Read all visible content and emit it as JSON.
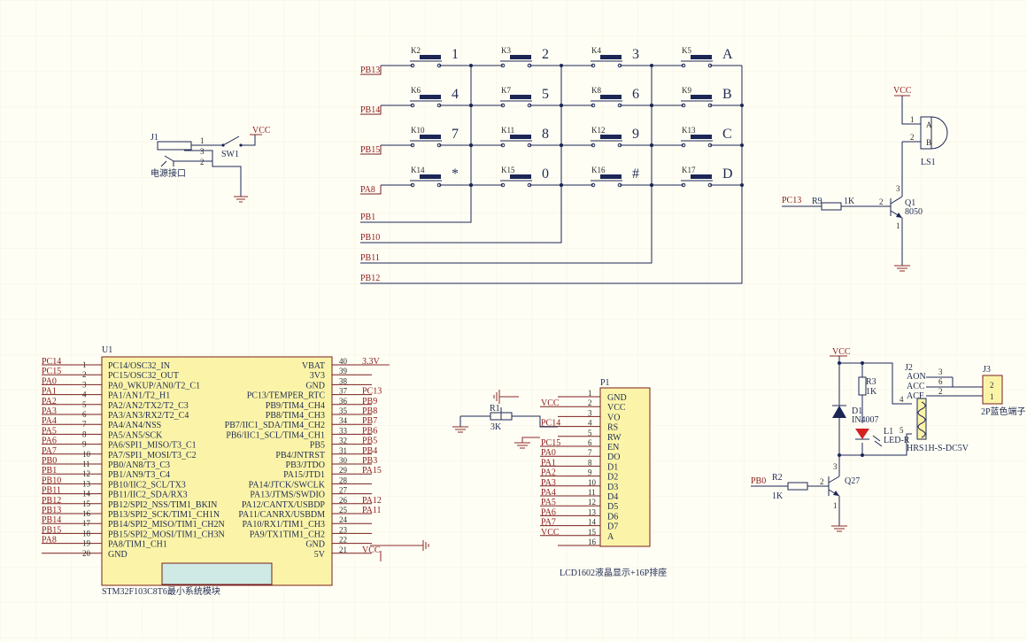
{
  "keypad": {
    "rows": [
      "PB13",
      "PB14",
      "PB15",
      "PA8"
    ],
    "cols": [
      "PB1",
      "PB10",
      "PB11",
      "PB12"
    ],
    "keys": [
      [
        {
          "ref": "K2",
          "label": "1"
        },
        {
          "ref": "K3",
          "label": "2"
        },
        {
          "ref": "K4",
          "label": "3"
        },
        {
          "ref": "K5",
          "label": "A"
        }
      ],
      [
        {
          "ref": "K6",
          "label": "4"
        },
        {
          "ref": "K7",
          "label": "5"
        },
        {
          "ref": "K8",
          "label": "6"
        },
        {
          "ref": "K9",
          "label": "B"
        }
      ],
      [
        {
          "ref": "K10",
          "label": "7"
        },
        {
          "ref": "K11",
          "label": "8"
        },
        {
          "ref": "K12",
          "label": "9"
        },
        {
          "ref": "K13",
          "label": "C"
        }
      ],
      [
        {
          "ref": "K14",
          "label": "*"
        },
        {
          "ref": "K15",
          "label": "0"
        },
        {
          "ref": "K16",
          "label": "#"
        },
        {
          "ref": "K17",
          "label": "D"
        }
      ]
    ]
  },
  "power": {
    "jack": "J1",
    "switch": "SW1",
    "vcc": "VCC",
    "label": "电源接口",
    "pins": [
      "1",
      "3",
      "2"
    ]
  },
  "buzzer": {
    "vcc": "VCC",
    "ref": "LS1",
    "pins": [
      "1",
      "2"
    ],
    "pin_names": [
      "A",
      "B"
    ],
    "net": "PC13",
    "res_ref": "R9",
    "res_val": "1K",
    "q_ref": "Q1",
    "q_type": "8050",
    "q_pins": [
      "2",
      "3",
      "1"
    ]
  },
  "mcu": {
    "ref": "U1",
    "title": "STM32F103C8T6最小系统模块",
    "left": [
      {
        "net": "PC14",
        "num": "1",
        "name": "PC14/OSC32_IN"
      },
      {
        "net": "PC15",
        "num": "2",
        "name": "PC15/OSC32_OUT"
      },
      {
        "net": "PA0",
        "num": "3",
        "name": "PA0_WKUP/AN0/T2_C1"
      },
      {
        "net": "PA1",
        "num": "4",
        "name": "PA1/AN1/T2_H1"
      },
      {
        "net": "PA2",
        "num": "5",
        "name": "PA2/AN2/TX2/T2_C3"
      },
      {
        "net": "PA3",
        "num": "6",
        "name": "PA3/AN3/RX2/T2_C4"
      },
      {
        "net": "PA4",
        "num": "7",
        "name": "PA4/AN4/NSS"
      },
      {
        "net": "PA5",
        "num": "8",
        "name": "PA5/AN5/SCK"
      },
      {
        "net": "PA6",
        "num": "9",
        "name": "PA6/SPI1_MISO/T3_C1"
      },
      {
        "net": "PA7",
        "num": "10",
        "name": "PA7/SPI1_MOSI/T3_C2"
      },
      {
        "net": "PB0",
        "num": "11",
        "name": "PB0/AN8/T3_C3"
      },
      {
        "net": "PB1",
        "num": "12",
        "name": "PB1/AN9/T3_C4"
      },
      {
        "net": "PB10",
        "num": "13",
        "name": "PB10/IIC2_SCL/TX3"
      },
      {
        "net": "PB11",
        "num": "14",
        "name": "PB11/IIC2_SDA/RX3"
      },
      {
        "net": "PB12",
        "num": "15",
        "name": "PB12/SPI2_NSS/TIM1_BKIN"
      },
      {
        "net": "PB13",
        "num": "16",
        "name": "PB13/SPI2_SCK/TIM1_CH1N"
      },
      {
        "net": "PB14",
        "num": "17",
        "name": "PB14/SPI2_MISO/TIM1_CH2N"
      },
      {
        "net": "PB15",
        "num": "18",
        "name": "PB15/SPI2_MOSI/TIM1_CH3N"
      },
      {
        "net": "PA8",
        "num": "19",
        "name": "PA8/TIM1_CH1"
      },
      {
        "net": "",
        "num": "20",
        "name": "GND"
      }
    ],
    "right": [
      {
        "name": "VBAT",
        "num": "40",
        "net": "3.3V"
      },
      {
        "name": "3V3",
        "num": "39",
        "net": ""
      },
      {
        "name": "GND",
        "num": "38",
        "net": ""
      },
      {
        "name": "PC13/TEMPER_RTC",
        "num": "37",
        "net": "PC13"
      },
      {
        "name": "PB9/TIM4_CH4",
        "num": "36",
        "net": "PB9"
      },
      {
        "name": "PB8/TIM4_CH3",
        "num": "35",
        "net": "PB8"
      },
      {
        "name": "PB7/IIC1_SDA/TIM4_CH2",
        "num": "34",
        "net": "PB7"
      },
      {
        "name": "PB6/IIC1_SCL/TIM4_CH1",
        "num": "33",
        "net": "PB6"
      },
      {
        "name": "PB5",
        "num": "32",
        "net": "PB5"
      },
      {
        "name": "PB4/JNTRST",
        "num": "31",
        "net": "PB4"
      },
      {
        "name": "PB3/JTDO",
        "num": "30",
        "net": "PB3"
      },
      {
        "name": "PA15/JTD1",
        "num": "29",
        "net": "PA15"
      },
      {
        "name": "PA14/JTCK/SWCLK",
        "num": "28",
        "net": ""
      },
      {
        "name": "PA13/JTMS/SWDIO",
        "num": "27",
        "net": ""
      },
      {
        "name": "PA12/CANTX/USBDP",
        "num": "26",
        "net": "PA12"
      },
      {
        "name": "PA11/CANRX/USBDM",
        "num": "25",
        "net": "PA11"
      },
      {
        "name": "PA10/RX1/TIM1_CH3",
        "num": "24",
        "net": ""
      },
      {
        "name": "PA9/TX1TIM1_CH2",
        "num": "23",
        "net": ""
      },
      {
        "name": "GND",
        "num": "22",
        "net": ""
      },
      {
        "name": "5V",
        "num": "21",
        "net": "VCC"
      }
    ]
  },
  "lcd": {
    "ref": "P1",
    "title": "LCD1602液晶显示+16P排座",
    "pins": [
      {
        "num": "1",
        "name": "GND",
        "net": ""
      },
      {
        "num": "2",
        "name": "VCC",
        "net": "VCC"
      },
      {
        "num": "3",
        "name": "VO",
        "net": ""
      },
      {
        "num": "4",
        "name": "RS",
        "net": "PC14"
      },
      {
        "num": "5",
        "name": "RW",
        "net": ""
      },
      {
        "num": "6",
        "name": "EN",
        "net": "PC15"
      },
      {
        "num": "7",
        "name": "DO",
        "net": "PA0"
      },
      {
        "num": "8",
        "name": "D1",
        "net": "PA1"
      },
      {
        "num": "9",
        "name": "D2",
        "net": "PA2"
      },
      {
        "num": "10",
        "name": "D3",
        "net": "PA3"
      },
      {
        "num": "11",
        "name": "D4",
        "net": "PA4"
      },
      {
        "num": "12",
        "name": "D5",
        "net": "PA5"
      },
      {
        "num": "13",
        "name": "D6",
        "net": "PA6"
      },
      {
        "num": "14",
        "name": "D7",
        "net": "PA7"
      },
      {
        "num": "15",
        "name": "A",
        "net": "VCC"
      },
      {
        "num": "16",
        "name": "",
        "net": ""
      }
    ],
    "res_ref": "R1",
    "res_val": "3K"
  },
  "relay": {
    "vcc": "VCC",
    "r3_ref": "R3",
    "r3_val": "1K",
    "d1_ref": "D1",
    "d1_type": "IN4007",
    "l1_ref": "L1",
    "l1_type": "LED-R",
    "relay_ref": "J2",
    "relay_type": "HRS1H-S-DC5V",
    "relay_pins": [
      {
        "name": "AON",
        "num": "3"
      },
      {
        "name": "ACC",
        "num": "6"
      },
      {
        "name": "ACF",
        "num": "2"
      }
    ],
    "coil_pins": [
      "4",
      "5"
    ],
    "term_ref": "J3",
    "term_type": "2P蓝色端子",
    "term_pins": [
      "2",
      "1"
    ],
    "net": "PB0",
    "r2_ref": "R2",
    "r2_val": "1K",
    "q_ref": "Q27",
    "q_pins": [
      "3",
      "2",
      "1"
    ]
  }
}
